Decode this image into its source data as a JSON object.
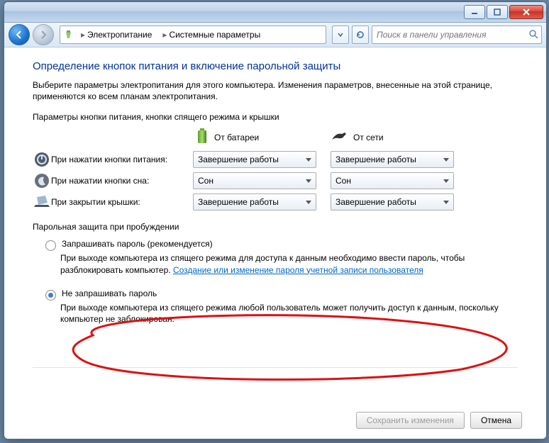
{
  "breadcrumb": {
    "level1": "Электропитание",
    "level2": "Системные параметры"
  },
  "search": {
    "placeholder": "Поиск в панели управления"
  },
  "heading": "Определение кнопок питания и включение парольной защиты",
  "intro": "Выберите параметры электропитания для этого компьютера. Изменения параметров, внесенные на этой странице, применяются ко всем планам электропитания.",
  "section_buttons": "Параметры кнопки питания, кнопки спящего режима и крышки",
  "col_battery": "От батареи",
  "col_ac": "От сети",
  "rows": {
    "power": {
      "label": "При нажатии кнопки питания:",
      "battery": "Завершение работы",
      "ac": "Завершение работы"
    },
    "sleep": {
      "label": "При нажатии кнопки сна:",
      "battery": "Сон",
      "ac": "Сон"
    },
    "lid": {
      "label": "При закрытии крышки:",
      "battery": "Завершение работы",
      "ac": "Завершение работы"
    }
  },
  "section_pwd": "Парольная защита при пробуждении",
  "opt1": {
    "label": "Запрашивать пароль (рекомендуется)",
    "desc_a": "При выходе компьютера из спящего режима для доступа к данным необходимо ввести пароль, чтобы разблокировать компьютер. ",
    "link": "Создание или изменение пароля учетной записи пользователя"
  },
  "opt2": {
    "label": "Не запрашивать пароль",
    "desc": "При выходе компьютера из спящего режима любой пользователь может получить доступ к данным, поскольку компьютер не заблокирован."
  },
  "buttons": {
    "save": "Сохранить изменения",
    "cancel": "Отмена"
  }
}
